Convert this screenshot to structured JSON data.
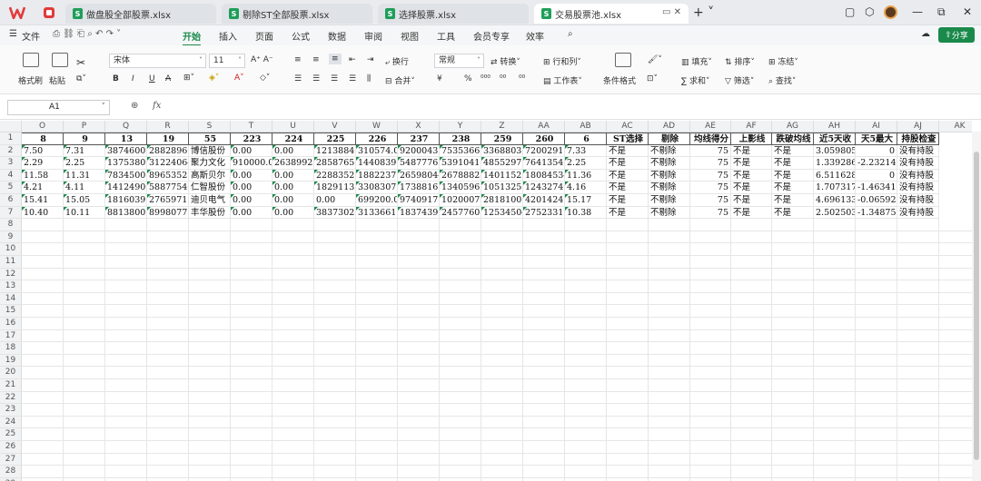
{
  "tabs": [
    {
      "label": "做盘股全部股票.xlsx",
      "active": false
    },
    {
      "label": "剔除ST全部股票.xlsx",
      "active": false
    },
    {
      "label": "选择股票.xlsx",
      "active": false
    },
    {
      "label": "交易股票池.xlsx",
      "active": true
    }
  ],
  "menu": {
    "file": "文件",
    "items": [
      "开始",
      "插入",
      "页面",
      "公式",
      "数据",
      "审阅",
      "视图",
      "工具",
      "会员专享",
      "效率"
    ],
    "active": "开始",
    "share": "分享"
  },
  "ribbon": {
    "format_painter": "格式刷",
    "paste": "粘贴",
    "font_name": "宋体",
    "font_size": "11",
    "wrap": "换行",
    "merge": "合并",
    "number_format": "常规",
    "convert": "转换",
    "row_col": "行和列",
    "worksheet": "工作表",
    "cond_format": "条件格式",
    "fill": "填充",
    "sort": "排序",
    "freeze": "冻结",
    "sum": "求和",
    "filter": "筛选",
    "find": "查找",
    "bold": "B",
    "italic": "I",
    "underline": "U",
    "strike": "A",
    "yen": "¥",
    "percent": "%",
    "inc": "⁰⁰",
    "dec": "⁰⁰"
  },
  "formula": {
    "name_box": "A1",
    "fx": "fx",
    "value": ""
  },
  "columns": [
    "O",
    "P",
    "Q",
    "R",
    "S",
    "T",
    "U",
    "V",
    "W",
    "X",
    "Y",
    "Z",
    "AA",
    "AB",
    "AC",
    "AD",
    "AE",
    "AF",
    "AG",
    "AH",
    "AI",
    "AJ",
    "AK"
  ],
  "header_row": [
    "8",
    "9",
    "13",
    "19",
    "55",
    "223",
    "224",
    "225",
    "226",
    "237",
    "238",
    "259",
    "260",
    "6",
    "ST选择",
    "剔除",
    "均线得分",
    "上影线",
    "跌破均线",
    "近5天收",
    "天5最大",
    "持股检查"
  ],
  "rows": [
    [
      "7.50",
      "7.31",
      "3874600.(",
      "28828961.",
      "博信股份",
      "0.00",
      "0.00",
      "1213884.",
      "310574.0(",
      "9200043.(",
      "7535366.",
      "3368803.(",
      "7200291.(",
      "7.33",
      "不是",
      "不剔除",
      "75",
      "不是",
      "不是",
      "3.059805",
      "0",
      "没有持股"
    ],
    [
      "2.29",
      "2.25",
      "13753800.(",
      "31224064.",
      "聚力文化",
      "910000.0(",
      "2638992.(",
      "2858765.(",
      "1440839.(",
      "5487776.",
      "5391041.",
      "4855297.(",
      "7641354.(",
      "2.25",
      "不是",
      "不剔除",
      "75",
      "不是",
      "不是",
      "1.339286",
      "-2.23214",
      "没有持股"
    ],
    [
      "11.58",
      "11.31",
      "7834500.(",
      "89653521.",
      "高斯贝尔",
      "0.00",
      "0.00",
      "2288352.",
      "1882237.",
      "26598044.",
      "26788828.",
      "14011526.",
      "18084534.",
      "11.36",
      "不是",
      "不剔除",
      "75",
      "不是",
      "不是",
      "6.511628",
      "0",
      "没有持股"
    ],
    [
      "4.21",
      "4.11",
      "14124900.",
      "58877540.",
      "仁智股份",
      "0.00",
      "0.00",
      "1829113.",
      "3308307.",
      "17388163.",
      "13405967.",
      "10513250.",
      "12432740.",
      "4.16",
      "不是",
      "不剔除",
      "75",
      "不是",
      "不是",
      "1.707317",
      "-1.46341",
      "没有持股"
    ],
    [
      "15.41",
      "15.05",
      "1816039.(",
      "27659715.",
      "迪贝电气",
      "0.00",
      "0.00",
      "0.00",
      "699200.0(",
      "9740917.(",
      "10200072.",
      "2818100.",
      "4201424.(",
      "15.17",
      "不是",
      "不剔除",
      "75",
      "不是",
      "不是",
      "4.696133",
      "-0.06592",
      "没有持股"
    ],
    [
      "10.40",
      "10.11",
      "8813800.(",
      "89980778.",
      "丰华股份",
      "0.00",
      "0.00",
      "3837302.",
      "3133661.",
      "18374390.",
      "24577608.",
      "12534504.",
      "27523313.",
      "10.38",
      "不是",
      "不剔除",
      "75",
      "不是",
      "不是",
      "2.502503",
      "-1.34875",
      "没有持股"
    ]
  ],
  "row_numbers": [
    "1",
    "2",
    "3",
    "4",
    "5",
    "6",
    "7",
    "8",
    "9",
    "10",
    "11",
    "12",
    "13",
    "14",
    "15",
    "16",
    "17",
    "18",
    "19",
    "20",
    "21",
    "22",
    "23",
    "24",
    "25",
    "26",
    "27",
    "28",
    "29"
  ]
}
